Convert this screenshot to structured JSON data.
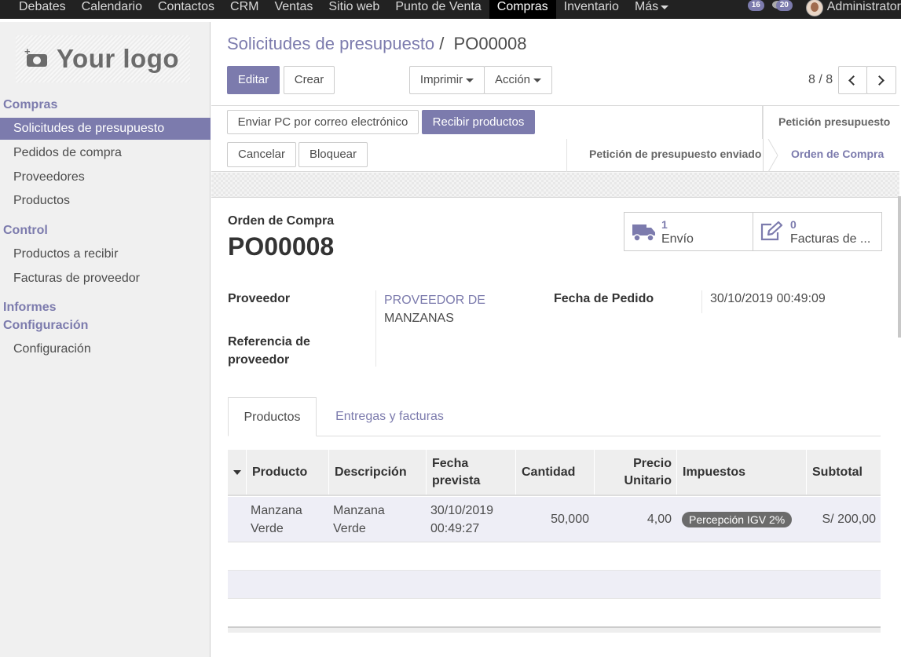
{
  "topbar": {
    "apps": [
      "Debates",
      "Calendario",
      "Contactos",
      "CRM",
      "Ventas",
      "Sitio web",
      "Punto de Venta",
      "Compras",
      "Inventario",
      "Más"
    ],
    "active_app": "Compras",
    "badge_activities": "16",
    "badge_messages": "20",
    "user_name": "Administrator"
  },
  "sidebar": {
    "logo_text": "Your logo",
    "section_compras": "Compras",
    "compras_items": [
      "Solicitudes de presupuesto",
      "Pedidos de compra",
      "Proveedores",
      "Productos"
    ],
    "section_control": "Control",
    "control_items": [
      "Productos a recibir",
      "Facturas de proveedor"
    ],
    "section_informes": "Informes",
    "section_config": "Configuración",
    "config_items": [
      "Configuración"
    ]
  },
  "breadcrumb": {
    "parent": "Solicitudes de presupuesto",
    "separator": "/",
    "current": "PO00008"
  },
  "toolbar": {
    "edit": "Editar",
    "create": "Crear",
    "print": "Imprimir",
    "action": "Acción",
    "pager": "8 / 8"
  },
  "header": {
    "send_po": "Enviar PC por correo electrónico",
    "receive": "Recibir productos",
    "cancel": "Cancelar",
    "lock": "Bloquear",
    "stage_request": "Petición presupuesto",
    "stage_sent": "Petición de presupuesto enviado",
    "stage_order": "Orden de Compra"
  },
  "form": {
    "doc_type": "Orden de Compra",
    "doc_name": "PO00008",
    "stat_shipping_count": "1",
    "stat_shipping_label": "Envío",
    "stat_invoice_count": "0",
    "stat_invoice_label": "Facturas de ...",
    "vendor_label": "Proveedor",
    "vendor_line1": "PROVEEDOR DE",
    "vendor_line2": "MANZANAS",
    "vendor_ref_label_1": "Referencia de",
    "vendor_ref_label_2": "proveedor",
    "order_date_label": "Fecha de Pedido",
    "order_date_value": "30/10/2019 00:49:09"
  },
  "tabs": [
    "Productos",
    "Entregas y facturas"
  ],
  "table": {
    "headers": {
      "product": "Producto",
      "description": "Descripción",
      "date_1": "Fecha",
      "date_2": "prevista",
      "qty": "Cantidad",
      "price_1": "Precio",
      "price_2": "Unitario",
      "taxes": "Impuestos",
      "subtotal": "Subtotal"
    },
    "row": {
      "product_1": "Manzana",
      "product_2": "Verde",
      "desc_1": "Manzana",
      "desc_2": "Verde",
      "date_1": "30/10/2019",
      "date_2": "00:49:27",
      "qty": "50,000",
      "price": "4,00",
      "tax": "Percepción IGV 2%",
      "subtotal": "S/ 200,00"
    }
  }
}
